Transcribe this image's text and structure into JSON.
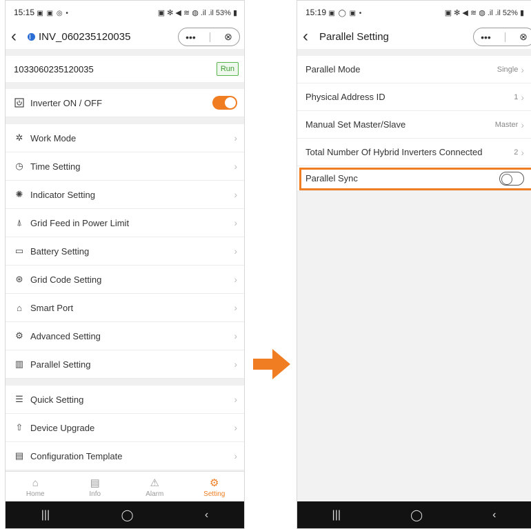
{
  "left": {
    "status": {
      "time": "15:15",
      "icons": "▣ ▣ ◎ •",
      "right": "▣ ✻ ◀ ≋ ◍ .il .il 53% ▮"
    },
    "nav": {
      "title": "INV_060235120035",
      "capsule_more": "•••",
      "capsule_close": "⊗"
    },
    "serial": "1033060235120035",
    "run_badge": "Run",
    "power": {
      "label": "Inverter ON / OFF",
      "state": "on"
    },
    "menu_group1": [
      {
        "label": "Work Mode",
        "icon": "gear-outline-icon"
      },
      {
        "label": "Time Setting",
        "icon": "clock-icon"
      },
      {
        "label": "Indicator Setting",
        "icon": "indicator-light-icon"
      },
      {
        "label": "Grid Feed in Power Limit",
        "icon": "power-tower-icon"
      },
      {
        "label": "Battery Setting",
        "icon": "battery-icon"
      },
      {
        "label": "Grid Code Setting",
        "icon": "grid-code-icon"
      },
      {
        "label": "Smart Port",
        "icon": "house-icon"
      },
      {
        "label": "Advanced Setting",
        "icon": "settings-icon"
      },
      {
        "label": "Parallel Setting",
        "icon": "parallel-icon"
      }
    ],
    "menu_group2": [
      {
        "label": "Quick Setting",
        "icon": "sliders-icon"
      },
      {
        "label": "Device Upgrade",
        "icon": "upgrade-arrow-icon"
      },
      {
        "label": "Configuration Template",
        "icon": "template-icon"
      }
    ],
    "tabs": [
      {
        "label": "Home",
        "icon": "home-icon",
        "active": false
      },
      {
        "label": "Info",
        "icon": "info-doc-icon",
        "active": false
      },
      {
        "label": "Alarm",
        "icon": "alarm-icon",
        "active": false
      },
      {
        "label": "Setting",
        "icon": "setting-icon",
        "active": true
      }
    ]
  },
  "right": {
    "status": {
      "time": "15:19",
      "icons": "▣ ◯ ▣ •",
      "right": "▣ ✻ ◀ ≋ ◍ .il .il 52% ▮"
    },
    "nav": {
      "title": "Parallel Setting",
      "capsule_more": "•••",
      "capsule_close": "⊗"
    },
    "rows": [
      {
        "label": "Parallel Mode",
        "value": "Single"
      },
      {
        "label": "Physical Address ID",
        "value": "1"
      },
      {
        "label": "Manual Set Master/Slave",
        "value": "Master"
      },
      {
        "label": "Total Number Of Hybrid Inverters Connected",
        "value": "2"
      }
    ],
    "sync": {
      "label": "Parallel Sync",
      "state": "off"
    }
  },
  "system_nav": {
    "recent": "|||",
    "home": "◯",
    "back": "‹"
  },
  "colors": {
    "accent": "#f07d21",
    "run_green": "#57b34c",
    "bluetooth": "#2b6fd6"
  }
}
